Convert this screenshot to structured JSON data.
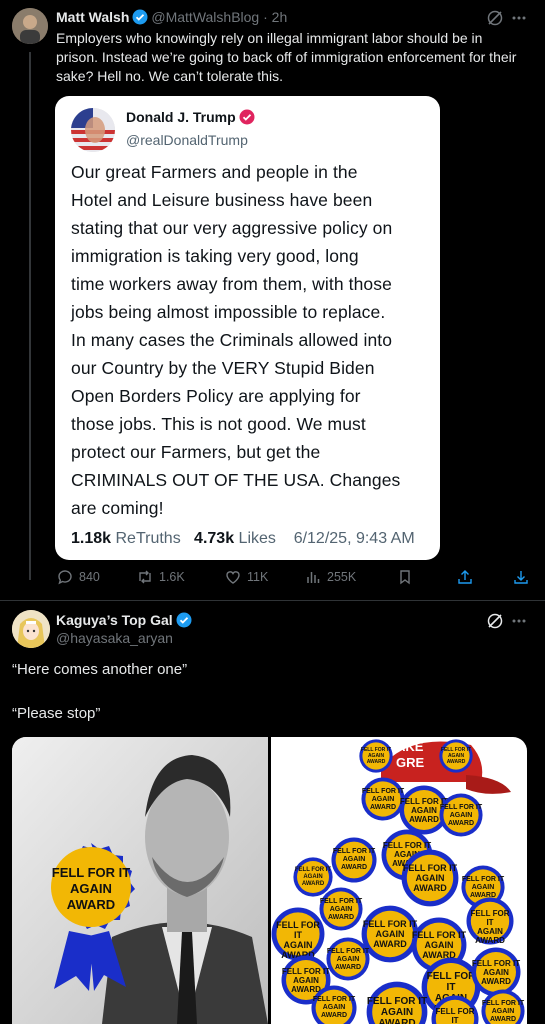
{
  "post1": {
    "author_name": "Matt Walsh",
    "handle": "@MattWalshBlog",
    "time": "· 2h",
    "text_lines": [
      "Employers who knowingly rely on illegal immigrant labor should be in",
      "prison. Instead we’re going to back off of immigration enforcement for their",
      "sake? Hell no. We can’t tolerate this."
    ],
    "quote": {
      "author_name": "Donald J. Trump",
      "handle": "@realDonaldTrump",
      "text_lines": [
        "Our great Farmers and people in the",
        "Hotel and Leisure business have been",
        "stating that our very aggressive policy on",
        "immigration is taking very good, long",
        "time workers away from them, with those",
        "jobs being almost impossible to replace.",
        "In many cases the Criminals allowed into",
        "our Country by the VERY Stupid Biden",
        "Open Borders Policy are applying for",
        "those jobs. This is not good. We must",
        "protect our Farmers, but get the",
        "CRIMINALS OUT OF THE USA. Changes",
        "are coming!"
      ],
      "retruths_count": "1.18k",
      "retruths_label": "ReTruths",
      "likes_count": "4.73k",
      "likes_label": "Likes",
      "timestamp": "6/12/25, 9:43 AM"
    },
    "actions": {
      "replies": "840",
      "reposts": "1.6K",
      "likes": "11K",
      "views": "255K"
    }
  },
  "post2": {
    "author_name": "Kaguya’s Top Gal",
    "handle": "@hayasaka_aryan",
    "line1": "“Here comes another one”",
    "line2": "“Please stop”",
    "media": {
      "left_badge": [
        "FELL FOR IT",
        "AGAIN",
        "AWARD"
      ],
      "right_badge_text": [
        "FELL FOR IT",
        "AGAIN",
        "AWARD"
      ],
      "hat_text": "AKE",
      "hat_text2": "GRE"
    }
  },
  "colors": {
    "verified": "#1d9bf0",
    "trump_verified": "#e0245e",
    "badge_yellow": "#f2b705",
    "badge_blue": "#1a2ec9"
  }
}
